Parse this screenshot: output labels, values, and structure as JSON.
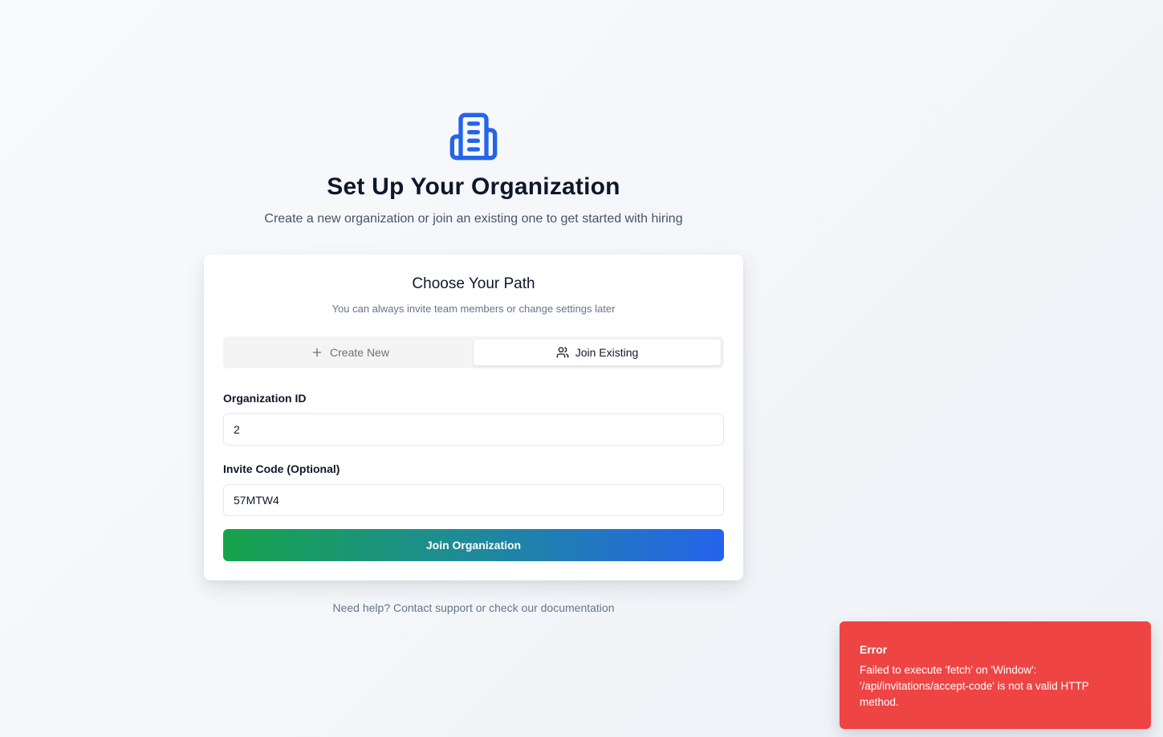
{
  "header": {
    "icon": "building-icon",
    "title": "Set Up Your Organization",
    "subtitle": "Create a new organization or join an existing one to get started with hiring"
  },
  "card": {
    "title": "Choose Your Path",
    "subtitle": "You can always invite team members or change settings later",
    "tabs": [
      {
        "label": "Create New",
        "icon": "plus-icon",
        "active": false
      },
      {
        "label": "Join Existing",
        "icon": "users-icon",
        "active": true
      }
    ],
    "form": {
      "organization_id": {
        "label": "Organization ID",
        "value": "2"
      },
      "invite_code": {
        "label": "Invite Code (Optional)",
        "value": "57MTW4"
      },
      "submit_label": "Join Organization"
    }
  },
  "footer": {
    "help_text": "Need help? Contact support or check our documentation"
  },
  "toast": {
    "title": "Error",
    "message": "Failed to execute 'fetch' on 'Window': '/api/invitations/accept-code' is not a valid HTTP method."
  },
  "colors": {
    "brand_blue": "#2563eb",
    "brand_green": "#16a34a",
    "error": "#ef4444"
  }
}
